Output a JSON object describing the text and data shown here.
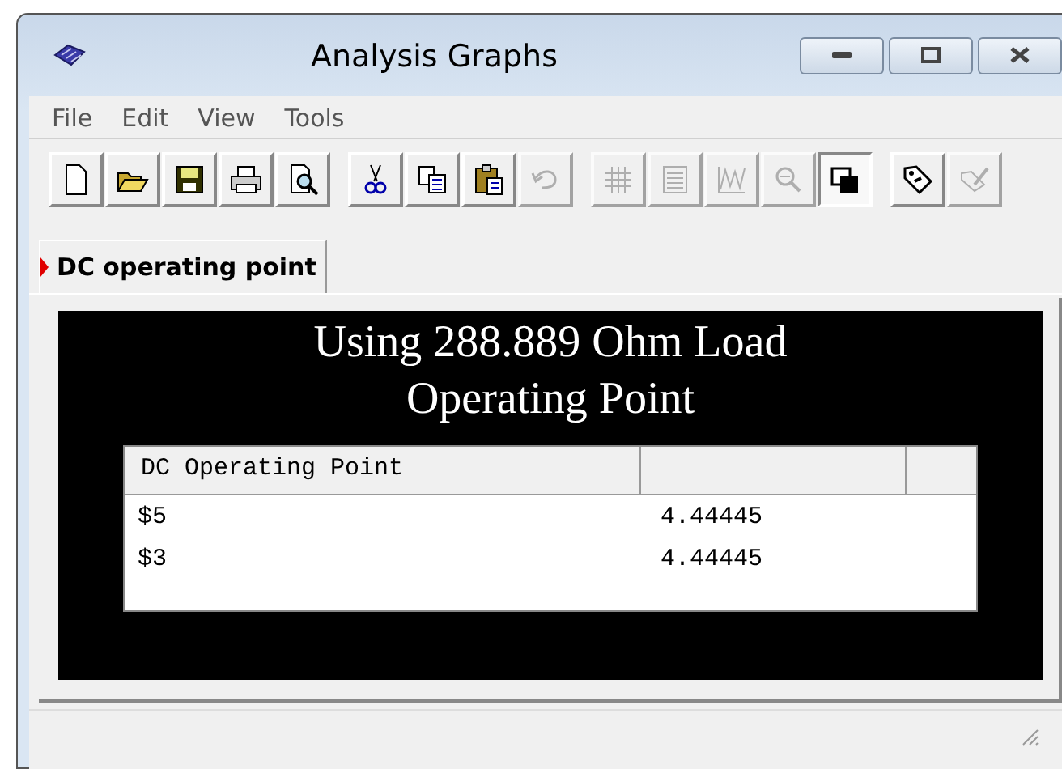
{
  "window": {
    "title": "Analysis Graphs"
  },
  "menu": [
    "File",
    "Edit",
    "View",
    "Tools"
  ],
  "toolbar": [
    [
      {
        "kind": "new",
        "disabled": false,
        "pressed": false
      },
      {
        "kind": "open",
        "disabled": false,
        "pressed": false
      },
      {
        "kind": "save",
        "disabled": false,
        "pressed": false
      },
      {
        "kind": "print",
        "disabled": false,
        "pressed": false
      },
      {
        "kind": "preview",
        "disabled": false,
        "pressed": false
      }
    ],
    [
      {
        "kind": "cut",
        "disabled": false,
        "pressed": false
      },
      {
        "kind": "copy",
        "disabled": false,
        "pressed": false
      },
      {
        "kind": "paste",
        "disabled": false,
        "pressed": false
      },
      {
        "kind": "undo",
        "disabled": true,
        "pressed": false
      }
    ],
    [
      {
        "kind": "grid",
        "disabled": true,
        "pressed": false
      },
      {
        "kind": "list",
        "disabled": true,
        "pressed": false
      },
      {
        "kind": "graph",
        "disabled": true,
        "pressed": false
      },
      {
        "kind": "zoom",
        "disabled": true,
        "pressed": false
      },
      {
        "kind": "overlap",
        "disabled": false,
        "pressed": true
      }
    ],
    [
      {
        "kind": "tag",
        "disabled": false,
        "pressed": false
      },
      {
        "kind": "edit",
        "disabled": true,
        "pressed": false
      }
    ]
  ],
  "tabs": [
    {
      "label": "DC operating point",
      "selected": true
    }
  ],
  "panel": {
    "title_lines": [
      "Using 288.889 Ohm Load",
      "Operating Point"
    ],
    "table": {
      "columns": [
        "DC Operating Point"
      ],
      "rows": [
        [
          "$5",
          "4.44445"
        ],
        [
          "$3",
          "4.44445"
        ]
      ]
    }
  }
}
